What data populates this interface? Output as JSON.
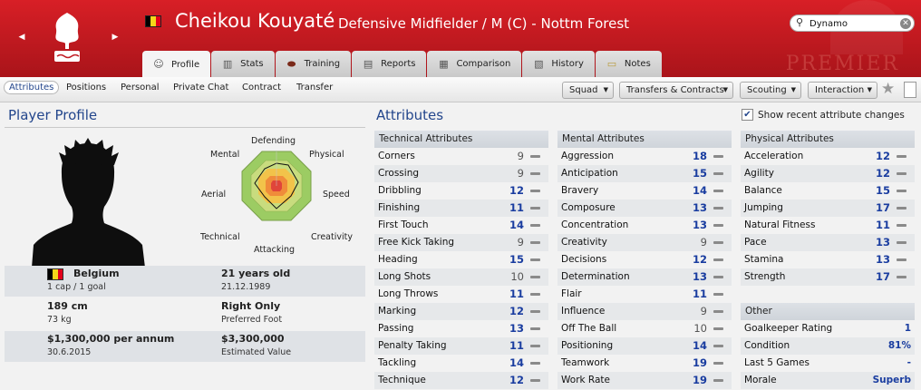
{
  "player": {
    "name": "Cheikou Kouyaté",
    "subtitle": "Defensive Midfielder / M (C) - Nottm Forest",
    "flag_colors": [
      "#000000",
      "#f7d61a",
      "#e3001b"
    ]
  },
  "header": {
    "watermark": "PREMIER",
    "nav_prev_icon": "triangle-left",
    "nav_next_icon": "triangle-right"
  },
  "search": {
    "value": "Dynamo",
    "icon": "search-icon"
  },
  "tabs": [
    {
      "label": "Profile",
      "icon": "person-icon",
      "active": true
    },
    {
      "label": "Stats",
      "icon": "bar-chart-icon"
    },
    {
      "label": "Training",
      "icon": "ball-icon"
    },
    {
      "label": "Reports",
      "icon": "report-icon"
    },
    {
      "label": "Comparison",
      "icon": "comparison-icon"
    },
    {
      "label": "History",
      "icon": "history-icon"
    },
    {
      "label": "Notes",
      "icon": "notes-icon"
    }
  ],
  "subnav": {
    "items": [
      "Attributes",
      "Positions",
      "Personal",
      "Private Chat",
      "Contract",
      "Transfer"
    ],
    "active": "Attributes"
  },
  "dropdowns": [
    "Squad",
    "Transfers & Contracts",
    "Scouting",
    "Interaction"
  ],
  "profile": {
    "title": "Player Profile",
    "radar_labels": {
      "top": "Defending",
      "top_right": "Physical",
      "right": "Speed",
      "bottom_right": "Creativity",
      "bottom": "Attacking",
      "bottom_left": "Technical",
      "left": "Aerial",
      "top_left": "Mental"
    },
    "nationality": "Belgium",
    "caps": "1 cap / 1 goal",
    "age": "21 years old",
    "dob": "21.12.1989",
    "height": "189 cm",
    "weight": "73 kg",
    "foot": "Right Only",
    "foot_label": "Preferred Foot",
    "wage": "$1,300,000 per annum",
    "contract_end": "30.6.2015",
    "value": "$3,300,000",
    "value_label": "Estimated Value"
  },
  "attributes": {
    "title": "Attributes",
    "show_recent_label": "Show recent attribute changes",
    "show_recent_checked": true,
    "technical": {
      "heading": "Technical Attributes",
      "rows": [
        {
          "name": "Corners",
          "value": "9"
        },
        {
          "name": "Crossing",
          "value": "9"
        },
        {
          "name": "Dribbling",
          "value": "12"
        },
        {
          "name": "Finishing",
          "value": "11"
        },
        {
          "name": "First Touch",
          "value": "14"
        },
        {
          "name": "Free Kick Taking",
          "value": "9"
        },
        {
          "name": "Heading",
          "value": "15"
        },
        {
          "name": "Long Shots",
          "value": "10"
        },
        {
          "name": "Long Throws",
          "value": "11"
        },
        {
          "name": "Marking",
          "value": "12"
        },
        {
          "name": "Passing",
          "value": "13"
        },
        {
          "name": "Penalty Taking",
          "value": "11"
        },
        {
          "name": "Tackling",
          "value": "14"
        },
        {
          "name": "Technique",
          "value": "12"
        }
      ]
    },
    "mental": {
      "heading": "Mental Attributes",
      "rows": [
        {
          "name": "Aggression",
          "value": "18"
        },
        {
          "name": "Anticipation",
          "value": "15"
        },
        {
          "name": "Bravery",
          "value": "14"
        },
        {
          "name": "Composure",
          "value": "13"
        },
        {
          "name": "Concentration",
          "value": "13"
        },
        {
          "name": "Creativity",
          "value": "9"
        },
        {
          "name": "Decisions",
          "value": "12"
        },
        {
          "name": "Determination",
          "value": "13"
        },
        {
          "name": "Flair",
          "value": "11"
        },
        {
          "name": "Influence",
          "value": "9"
        },
        {
          "name": "Off The Ball",
          "value": "10"
        },
        {
          "name": "Positioning",
          "value": "14"
        },
        {
          "name": "Teamwork",
          "value": "19"
        },
        {
          "name": "Work Rate",
          "value": "19"
        }
      ]
    },
    "physical": {
      "heading": "Physical Attributes",
      "rows": [
        {
          "name": "Acceleration",
          "value": "12"
        },
        {
          "name": "Agility",
          "value": "12"
        },
        {
          "name": "Balance",
          "value": "15"
        },
        {
          "name": "Jumping",
          "value": "17"
        },
        {
          "name": "Natural Fitness",
          "value": "11"
        },
        {
          "name": "Pace",
          "value": "13"
        },
        {
          "name": "Stamina",
          "value": "13"
        },
        {
          "name": "Strength",
          "value": "17"
        }
      ]
    },
    "other": {
      "heading": "Other",
      "rows": [
        {
          "name": "Goalkeeper Rating",
          "value": "1"
        },
        {
          "name": "Condition",
          "value": "81%"
        },
        {
          "name": "Last 5 Games",
          "value": "-"
        },
        {
          "name": "Morale",
          "value": "Superb"
        }
      ]
    }
  }
}
